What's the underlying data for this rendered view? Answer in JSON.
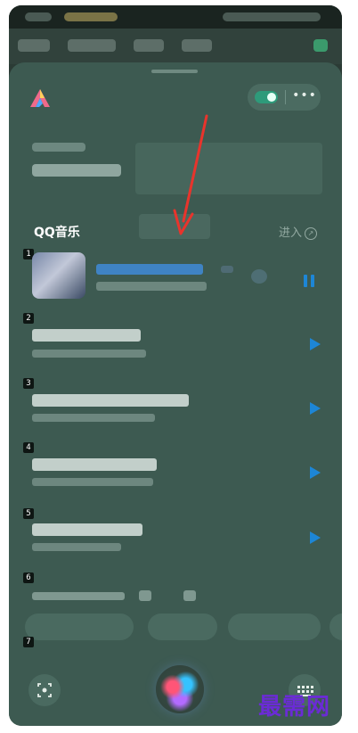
{
  "colors": {
    "panel": "#3d5a51",
    "accent_blue": "#1d86d6",
    "toggle_green": "#2e9a7a",
    "arrow_red": "#e8342c",
    "watermark": "#6b2bd6"
  },
  "music_card": {
    "title": "QQ音乐",
    "enter_label": "进入",
    "enter_icon": "arrow-up-right-circle-icon"
  },
  "tracks": [
    {
      "rank": "1",
      "state": "playing",
      "icon": "pause-icon"
    },
    {
      "rank": "2",
      "state": "paused",
      "icon": "play-icon"
    },
    {
      "rank": "3",
      "state": "paused",
      "icon": "play-icon"
    },
    {
      "rank": "4",
      "state": "paused",
      "icon": "play-icon"
    },
    {
      "rank": "5",
      "state": "paused",
      "icon": "play-icon"
    },
    {
      "rank": "6",
      "state": "feedback",
      "icon": "thumbs-up-icon"
    },
    {
      "rank": "7",
      "state": "hidden",
      "icon": ""
    }
  ],
  "bottom_bar": {
    "left_icon": "screen-scan-icon",
    "center_icon": "siri-orb-icon",
    "right_icon": "keyboard-icon"
  },
  "watermark": "最需网"
}
